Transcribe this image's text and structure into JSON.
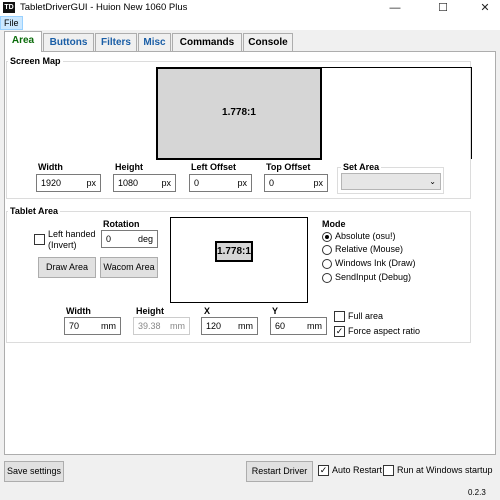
{
  "window": {
    "icon_text": "TD",
    "title": "TabletDriverGUI - Huion New 1060 Plus",
    "minimize_glyph": "—",
    "maximize_glyph": "☐",
    "close_glyph": "✕"
  },
  "menu": {
    "file": "File"
  },
  "tabs": [
    "Area",
    "Buttons",
    "Filters",
    "Misc",
    "Commands",
    "Console"
  ],
  "screen_map": {
    "title": "Screen Map",
    "ratio": "1.778:1",
    "width_label": "Width",
    "width_value": "1920",
    "width_unit": "px",
    "height_label": "Height",
    "height_value": "1080",
    "height_unit": "px",
    "left_offset_label": "Left Offset",
    "left_offset_value": "0",
    "left_offset_unit": "px",
    "top_offset_label": "Top Offset",
    "top_offset_value": "0",
    "top_offset_unit": "px",
    "set_area_label": "Set Area",
    "set_area_value": "",
    "dropdown_glyph": "⌄"
  },
  "tablet_area": {
    "title": "Tablet Area",
    "left_handed_line1": "Left handed",
    "left_handed_line2": "(Invert)",
    "left_handed_checked": false,
    "rotation_label": "Rotation",
    "rotation_value": "0",
    "rotation_unit": "deg",
    "draw_area_button": "Draw Area",
    "wacom_area_button": "Wacom Area",
    "ratio": "1.778:1",
    "mode_label": "Mode",
    "modes": [
      "Absolute (osu!)",
      "Relative (Mouse)",
      "Windows Ink (Draw)",
      "SendInput (Debug)"
    ],
    "selected_mode": 0,
    "width_label": "Width",
    "width_value": "70",
    "width_unit": "mm",
    "height_label": "Height",
    "height_value": "39.38",
    "height_unit": "mm",
    "x_label": "X",
    "x_value": "120",
    "x_unit": "mm",
    "y_label": "Y",
    "y_value": "60",
    "y_unit": "mm",
    "full_area_label": "Full area",
    "full_area_checked": false,
    "force_aspect_label": "Force aspect ratio",
    "force_aspect_checked": true
  },
  "bottom": {
    "save_settings": "Save settings",
    "restart_driver": "Restart Driver",
    "auto_restart_label": "Auto Restart",
    "auto_restart_checked": true,
    "run_at_startup_label": "Run at Windows startup",
    "run_at_startup_checked": false,
    "version": "0.2.3"
  },
  "check_glyph": "✓"
}
